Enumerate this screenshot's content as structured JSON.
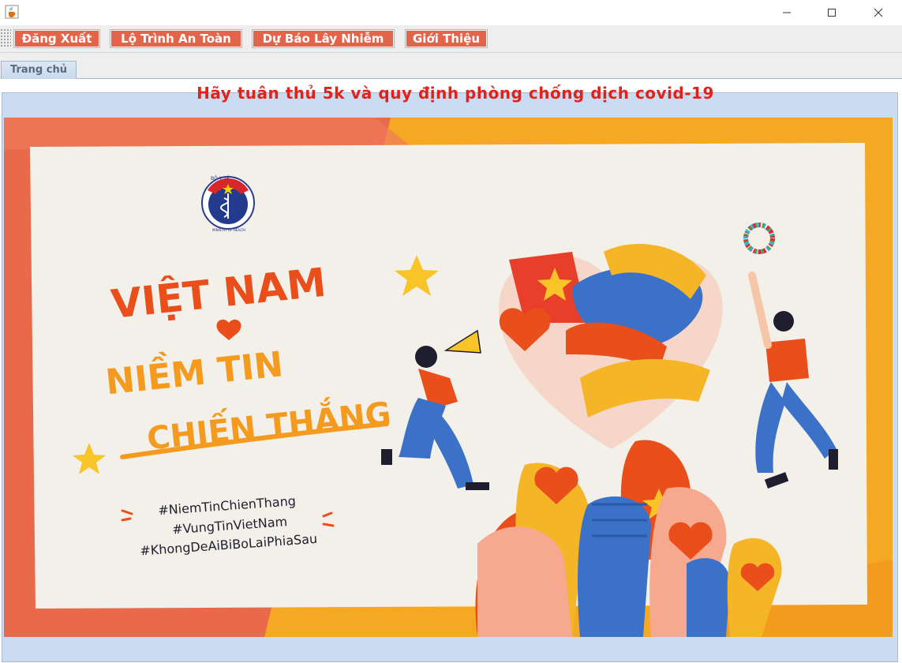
{
  "window": {
    "title": ""
  },
  "menu": {
    "logout_label": "Đăng Xuất",
    "safe_route_label": "Lộ Trình An Toàn",
    "infection_forecast_label": "Dự Báo Lây Nhiễm",
    "intro_label": "Giới Thiệu"
  },
  "tabs": [
    {
      "label": "Trang chủ",
      "selected": true
    }
  ],
  "main": {
    "heading": "Hãy tuân thủ 5k và quy định phòng chống dịch covid-19",
    "banner": {
      "logo_text": "BỘ Y TẾ",
      "logo_subtext": "MINISTRY OF HEALTH",
      "title_line1": "VIỆT NAM",
      "title_line2": "NIỀM TIN",
      "title_line3": "CHIẾN THẮNG",
      "hashtags": [
        "#NiemTinChienThang",
        "#VungTinVietNam",
        "#KhongDeAiBiBoLaiPhiaSau"
      ]
    }
  },
  "colors": {
    "menu_button_bg": "#e2644a",
    "heading_red": "#e4201a",
    "panel_bg": "#c9dcf1",
    "banner_orange": "#f4a823",
    "banner_coral": "#e96a4a",
    "hand_blue": "#3b72c7"
  },
  "icons": {
    "app": "java-cup-icon",
    "minimize": "minimize-icon",
    "maximize": "maximize-icon",
    "close": "close-icon"
  }
}
